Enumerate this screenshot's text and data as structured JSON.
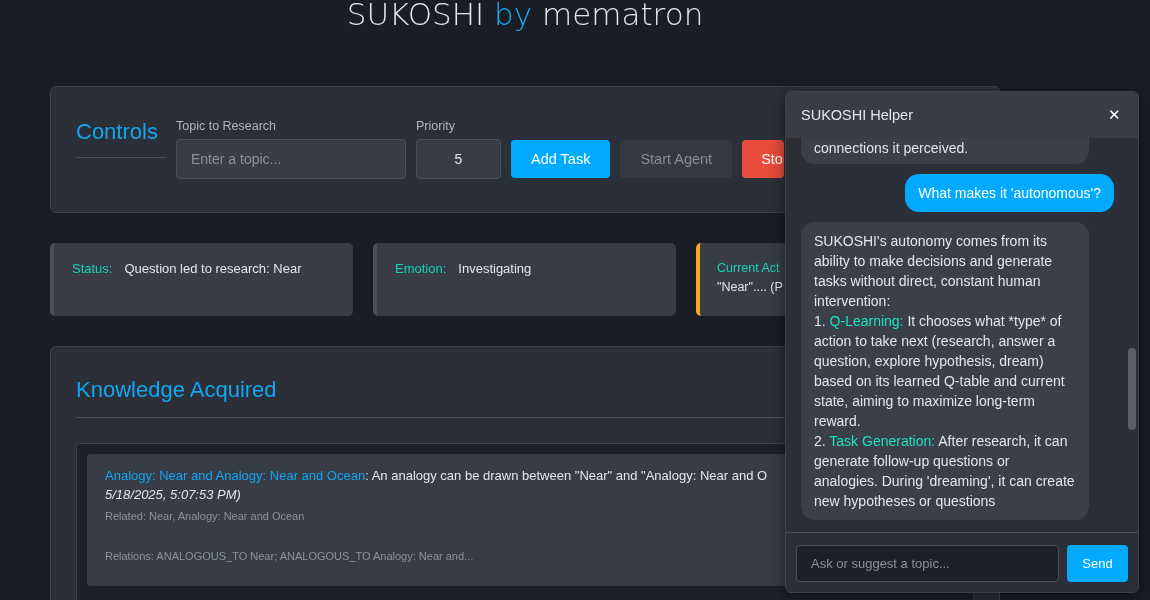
{
  "header": {
    "brand": "SUKOSHI",
    "joiner": "by",
    "author": "mematron"
  },
  "controls": {
    "title": "Controls",
    "topic": {
      "label": "Topic to Research",
      "placeholder": "Enter a topic..."
    },
    "priority": {
      "label": "Priority",
      "value": "5"
    },
    "buttons": [
      {
        "label": "Add Task",
        "kind": "primary",
        "disabled": false
      },
      {
        "label": "Start Agent",
        "kind": "secondary",
        "disabled": true
      },
      {
        "label": "Sto",
        "kind": "danger",
        "disabled": false
      }
    ]
  },
  "status_cards": [
    {
      "label": "Status:",
      "value": "Question led to research: Near",
      "highlighted": false
    },
    {
      "label": "Emotion:",
      "value": "Investigating",
      "highlighted": false
    },
    {
      "label": "Current Act",
      "value": "\"Near\".... (P",
      "highlighted": true
    }
  ],
  "knowledge": {
    "title": "Knowledge Acquired",
    "items": [
      {
        "topic": "Analogy: Near and Analogy: Near and Ocean",
        "description": ": An analogy can be drawn between \"Near\" and \"Analogy: Near and O",
        "timestamp": "5/18/2025, 5:07:53 PM)",
        "related": "Related: Near, Analogy: Near and Ocean",
        "relations": "Relations: ANALOGOUS_TO Near; ANALOGOUS_TO Analogy: Near and..."
      }
    ]
  },
  "chat": {
    "title": "SUKOSHI Helper",
    "close": "✕",
    "messages": [
      {
        "kind": "bot",
        "parts": [
          {
            "kind": "plain",
            "text": "connections it perceived."
          }
        ]
      },
      {
        "kind": "user",
        "parts": [
          {
            "kind": "plain",
            "text": "What makes it 'autonomous'?"
          }
        ]
      },
      {
        "kind": "bot",
        "parts": [
          {
            "kind": "plain",
            "text": "SUKOSHI's autonomy comes from its ability to make decisions and generate tasks without direct, constant human intervention:\n1. "
          },
          {
            "kind": "term",
            "text": "Q-Learning:"
          },
          {
            "kind": "plain",
            "text": " It chooses what *type* of action to take next (research, answer a question, explore hypothesis, dream) based on its learned Q-table and current state, aiming to maximize long-term reward.\n2. "
          },
          {
            "kind": "term",
            "text": "Task Generation:"
          },
          {
            "kind": "plain",
            "text": " After research, it can generate follow-up questions or analogies. During 'dreaming', it can create new hypotheses or questions"
          }
        ]
      }
    ],
    "input": {
      "placeholder": "Ask or suggest a topic..."
    },
    "send": "Send"
  }
}
